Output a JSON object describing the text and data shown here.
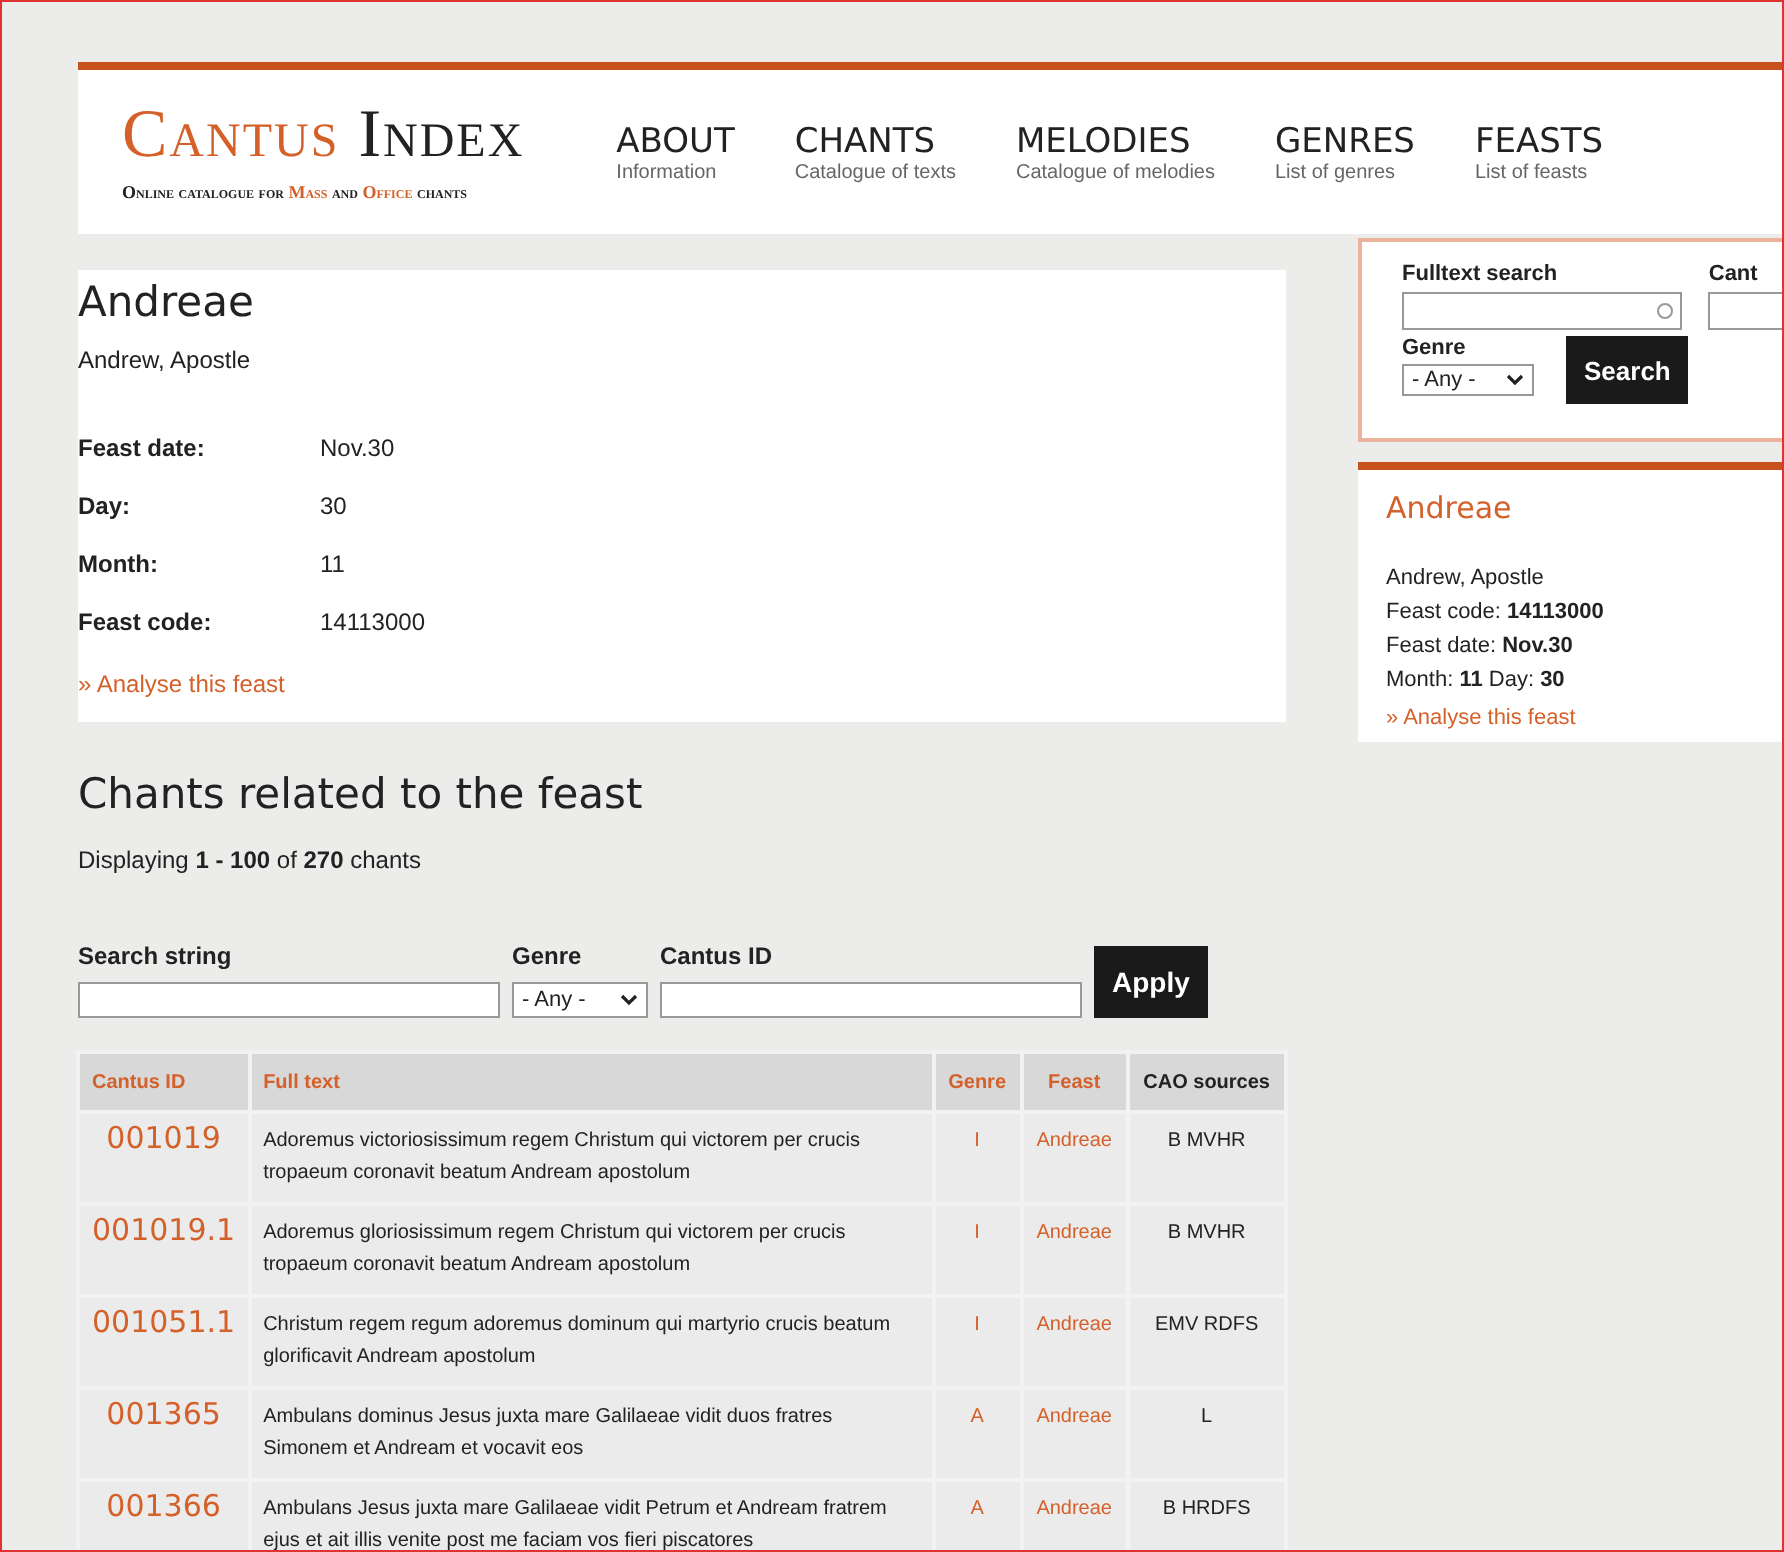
{
  "logo": {
    "title": "Cantus Index",
    "subtitle": [
      {
        "text": "Online catalogue for ",
        "highlight": false
      },
      {
        "text": "Mass",
        "highlight": true
      },
      {
        "text": " and ",
        "highlight": false
      },
      {
        "text": "Office",
        "highlight": true
      },
      {
        "text": " chants",
        "highlight": false
      }
    ]
  },
  "nav": [
    {
      "title": "ABOUT",
      "sub": "Information"
    },
    {
      "title": "CHANTS",
      "sub": "Catalogue of texts"
    },
    {
      "title": "MELODIES",
      "sub": "Catalogue of melodies"
    },
    {
      "title": "GENRES",
      "sub": "List of genres"
    },
    {
      "title": "FEASTS",
      "sub": "List of feasts"
    }
  ],
  "feast": {
    "title": "Andreae",
    "description": "Andrew, Apostle",
    "fields": [
      {
        "label": "Feast date:",
        "value": "Nov.30"
      },
      {
        "label": "Day:",
        "value": "30"
      },
      {
        "label": "Month:",
        "value": "11"
      },
      {
        "label": "Feast code:",
        "value": "14113000"
      }
    ],
    "link": "» Analyse this feast"
  },
  "chants": {
    "title": "Chants related to the feast",
    "summary": "Displaying **1 - 100** of **270** chants",
    "filters": {
      "search_label": "Search string",
      "genre_label": "Genre",
      "genre_value": "- Any -",
      "id_label": "Cantus ID",
      "apply": "Apply"
    },
    "columns": [
      {
        "label": "Cantus ID",
        "link": true
      },
      {
        "label": "Full text",
        "link": true
      },
      {
        "label": "Genre",
        "link": true
      },
      {
        "label": "Feast",
        "link": true
      },
      {
        "label": "CAO sources",
        "link": false
      }
    ],
    "rows": [
      {
        "id": "001019",
        "text": "Adoremus victoriosissimum regem Christum qui victorem per crucis tropaeum coronavit beatum Andream apostolum",
        "genre": "I",
        "feast": "Andreae",
        "sources": "B MVHR"
      },
      {
        "id": "001019.1",
        "text": "Adoremus gloriosissimum regem Christum qui victorem per crucis tropaeum coronavit beatum Andream apostolum",
        "genre": "I",
        "feast": "Andreae",
        "sources": "B MVHR"
      },
      {
        "id": "001051.1",
        "text": "Christum regem regum adoremus dominum qui martyrio crucis beatum glorificavit Andream apostolum",
        "genre": "I",
        "feast": "Andreae",
        "sources": "EMV RDFS"
      },
      {
        "id": "001365",
        "text": "Ambulans dominus Jesus juxta mare Galilaeae vidit duos fratres Simonem et Andream et vocavit eos",
        "genre": "A",
        "feast": "Andreae",
        "sources": "L"
      },
      {
        "id": "001366",
        "text": "Ambulans Jesus juxta mare Galilaeae vidit Petrum et Andream fratrem ejus et ait illis venite post me faciam vos fieri piscatores",
        "genre": "A",
        "feast": "Andreae",
        "sources": "B HRDFS"
      }
    ]
  },
  "sidebar": {
    "search": {
      "fulltext_label": "Fulltext search",
      "id_label": "Cant",
      "genre_label": "Genre",
      "genre_value": "- Any -",
      "button": "Search"
    },
    "feast": {
      "title": "Andreae",
      "lines": [
        "Andrew, Apostle",
        "Feast code: **14113000**",
        "Feast date: **Nov.30**",
        "Month: **11** Day: **30**"
      ],
      "link": "» Analyse this feast"
    }
  }
}
